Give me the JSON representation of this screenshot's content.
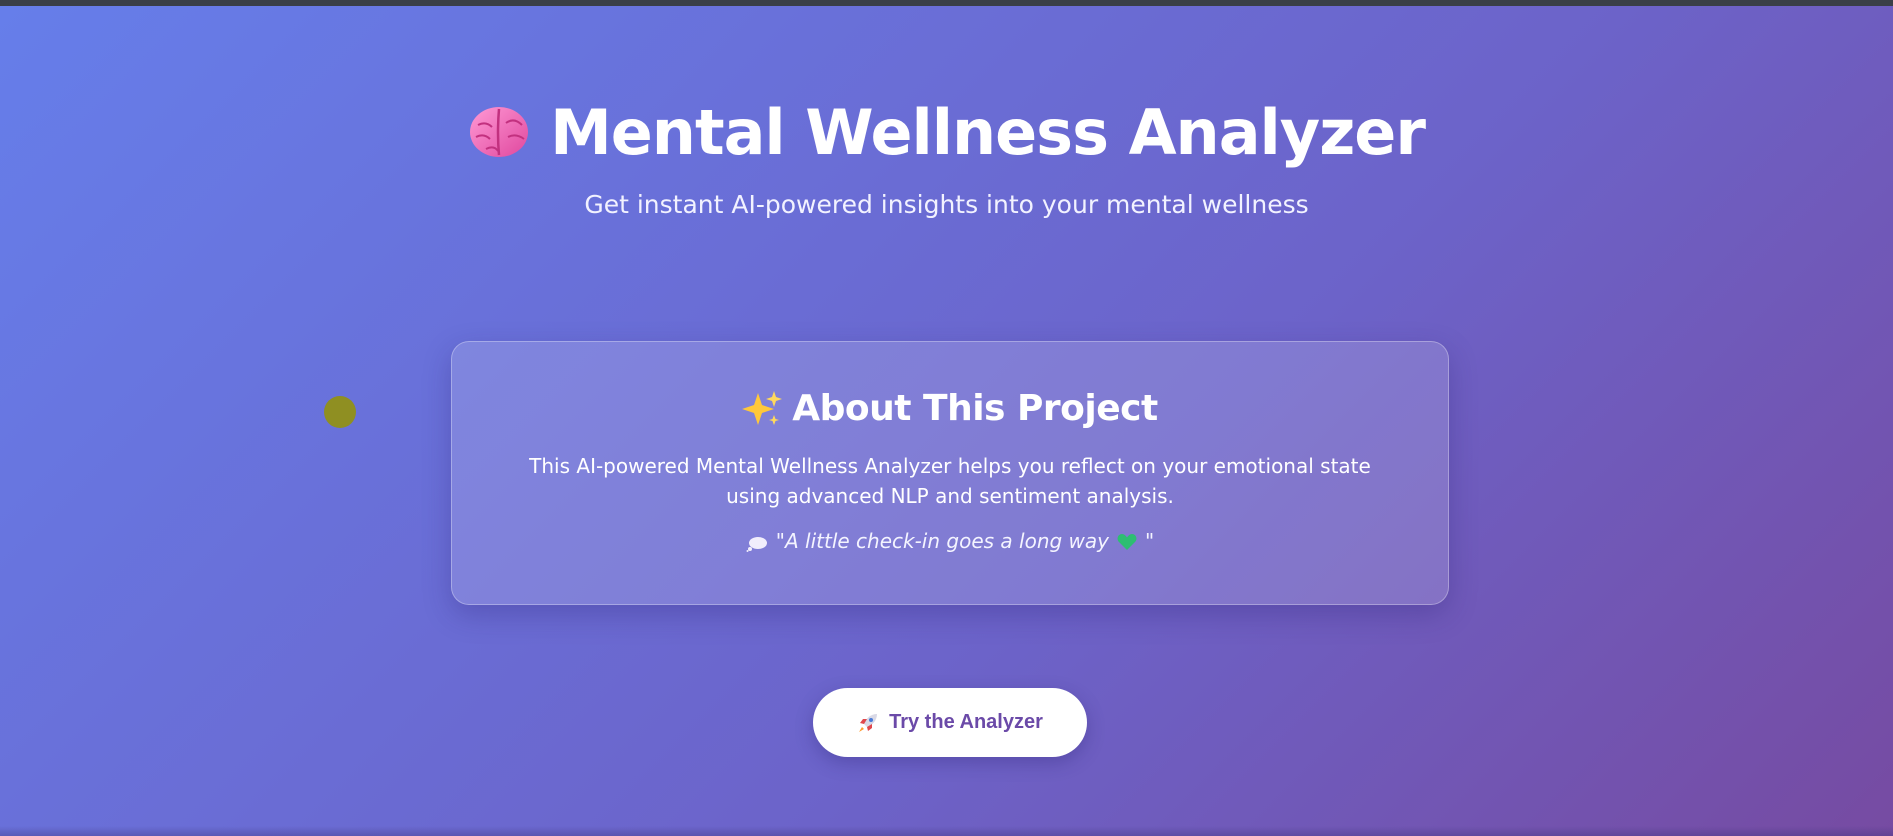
{
  "header": {
    "title": "Mental Wellness Analyzer",
    "subtitle": "Get instant AI-powered insights into your mental wellness",
    "title_icon": "brain-icon"
  },
  "about": {
    "title": "About This Project",
    "title_icon": "sparkle-icon",
    "description": "This AI-powered Mental Wellness Analyzer helps you reflect on your emotional state using advanced NLP and sentiment analysis.",
    "quote": "\"A little check-in goes a long way",
    "quote_end": "\"",
    "quote_icon": "thought-bubble-icon",
    "quote_end_icon": "green-heart-icon"
  },
  "cta": {
    "label": "Try the Analyzer",
    "icon": "rocket-icon"
  },
  "colors": {
    "background_start": "#667eea",
    "background_end": "#764ba2",
    "button_text": "#6b4aa8",
    "cursor_dot": "#8f8f22"
  }
}
